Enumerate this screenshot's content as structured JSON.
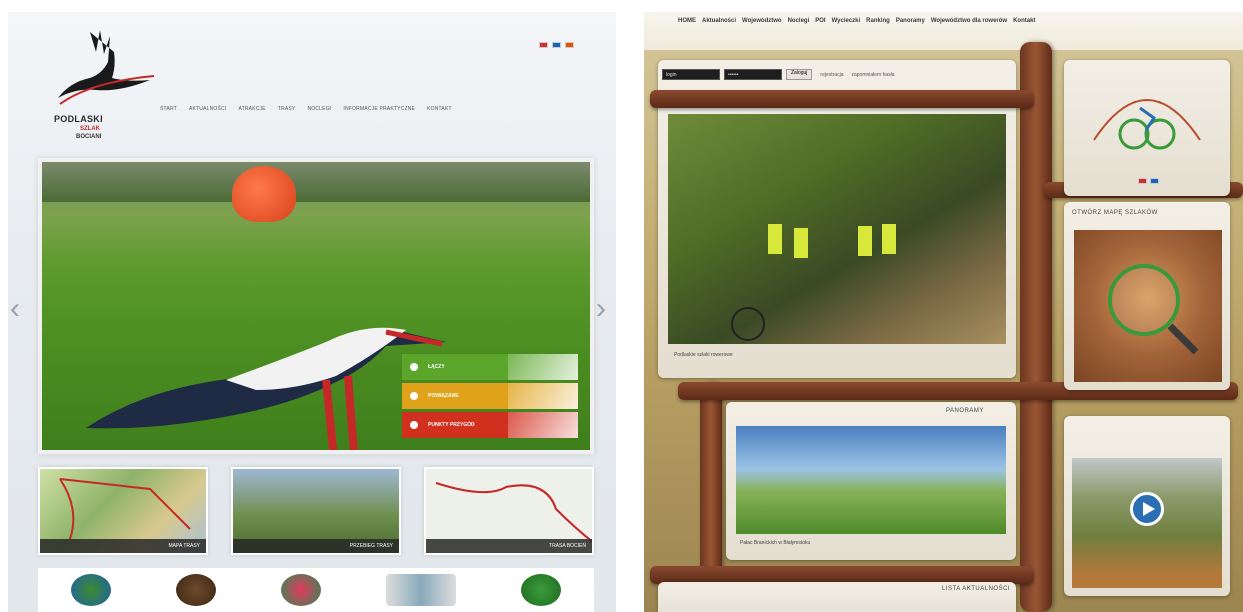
{
  "left_site": {
    "logo": {
      "name": "PODLASKI",
      "line2": "SZLAK",
      "line3": "BOCIANI"
    },
    "nav": [
      "START",
      "AKTUALNOŚCI",
      "ATRAKCJE",
      "TRASY",
      "NOCLEGI",
      "INFORMACJE PRAKTYCZNE",
      "KONTAKT"
    ],
    "flags": [
      "#d32f2f",
      "#1565c0",
      "#e65100"
    ],
    "slider": {
      "prev_glyph": "‹",
      "next_glyph": "›",
      "buttons": [
        {
          "label": "ŁĄCZY",
          "color": "#5aa52a"
        },
        {
          "label": "POWIĄZANE",
          "color": "#e0a21a"
        },
        {
          "label": "PUNKTY PRZYGÓD",
          "color": "#d2301f"
        }
      ]
    },
    "thumbs": [
      {
        "caption": "MAPA TRASY"
      },
      {
        "caption": "PRZEBIEG TRASY"
      },
      {
        "caption": "TRASA BOCIEŃ"
      }
    ],
    "partners": [
      "partner-1",
      "partner-2",
      "partner-3",
      "partner-4",
      "partner-5"
    ]
  },
  "right_site": {
    "menu": [
      "HOME",
      "Aktualności",
      "Województwo",
      "Noclegi",
      "POI",
      "Wycieczki",
      "Ranking",
      "Panoramy",
      "Województwo dla rowerów",
      "Kontakt"
    ],
    "login": {
      "user_value": "login",
      "pass_value": "••••••",
      "submit": "Zaloguj",
      "register": "rejestracja",
      "forgot": "zapomniałem hasła"
    },
    "main_photo_caption": "Podlaskie szlaki rowerowe",
    "map_heading": "OTWÓRZ MAPĘ SZLAKÓW",
    "panorama_heading": "PANORAMY",
    "panorama_caption": "Pałac Branickich w Białymstoku",
    "news_heading": "LISTA AKTUALNOŚCI",
    "flags": [
      "#d32f2f",
      "#1565c0"
    ]
  }
}
